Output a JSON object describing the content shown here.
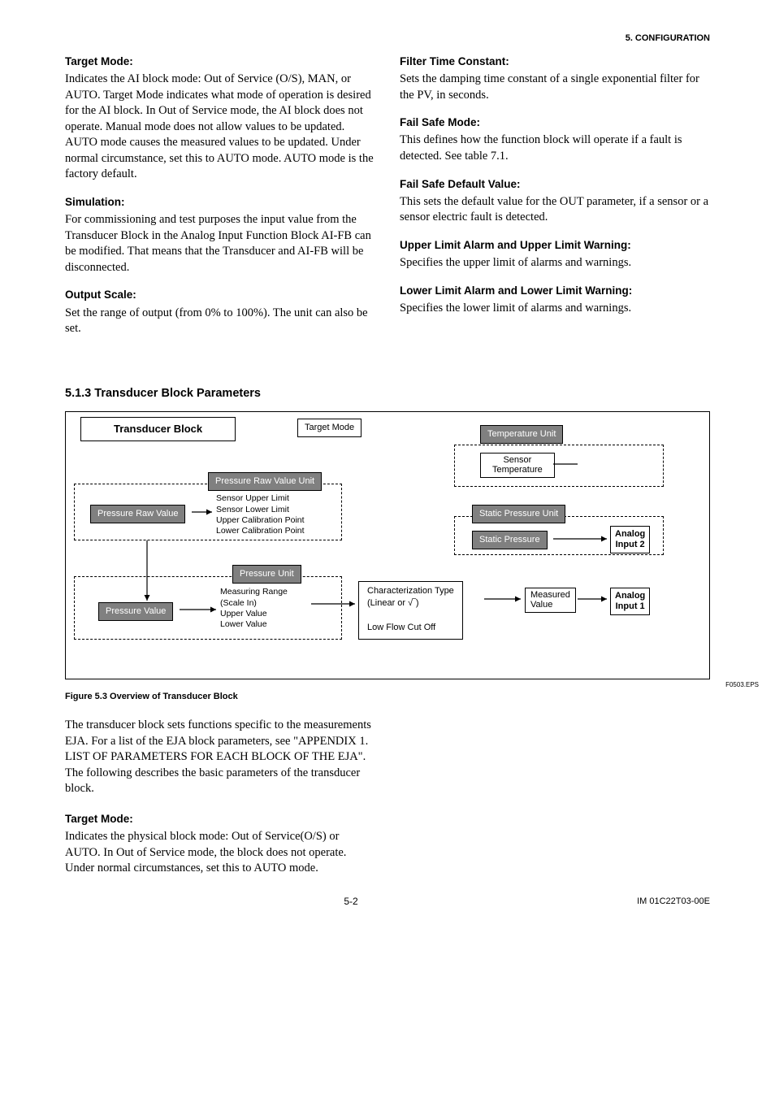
{
  "header": {
    "section": "5.  CONFIGURATION"
  },
  "left": {
    "target_mode": {
      "title": "Target Mode:",
      "body": "Indicates the AI block mode: Out of Service (O/S), MAN, or AUTO. Target Mode indicates what mode of operation is desired for the AI block. In Out of Service mode, the AI block does not operate. Manual mode does not allow values to be updated. AUTO mode causes the measured values to be updated. Under normal circumstance, set this to AUTO mode. AUTO mode is the factory default."
    },
    "simulation": {
      "title": "Simulation:",
      "body": "For commissioning and test purposes the input value from the Transducer Block in the Analog Input Function Block AI-FB can be modified. That means that the Transducer and AI-FB will be disconnected."
    },
    "output_scale": {
      "title": "Output Scale:",
      "body": "Set the range of output (from 0% to 100%). The unit can also be set."
    }
  },
  "right": {
    "filter": {
      "title": "Filter Time Constant:",
      "body": "Sets the damping time constant of a single exponential filter for the PV, in seconds."
    },
    "fail_safe_mode": {
      "title": "Fail Safe Mode:",
      "body": "This defines how the function block will operate if a fault is detected. See table 7.1."
    },
    "fail_safe_default": {
      "title": "Fail Safe Default Value:",
      "body": "This sets the default value for the OUT parameter, if a sensor or a sensor electric fault is detected."
    },
    "upper_limit": {
      "title": "Upper Limit Alarm and Upper Limit Warning:",
      "body": "Specifies the upper limit of alarms and warnings."
    },
    "lower_limit": {
      "title": "Lower Limit Alarm and Lower Limit Warning:",
      "body": "Specifies the lower limit of alarms and warnings."
    }
  },
  "section_513": {
    "title": "5.1.3 Transducer Block Parameters"
  },
  "diagram": {
    "title": "Transducer Block",
    "target_mode": "Target Mode",
    "temp_unit": "Temperature Unit",
    "sensor_temp_l1": "Sensor",
    "sensor_temp_l2": "Temperature",
    "prv_unit": "Pressure Raw Value Unit",
    "limits_l1": "Sensor Upper Limit",
    "limits_l2": "Sensor Lower Limit",
    "limits_l3": "Upper Calibration Point",
    "limits_l4": "Lower Calibration Point",
    "prv": "Pressure Raw Value",
    "sp_unit": "Static Pressure Unit",
    "static_pressure": "Static Pressure",
    "pressure_unit": "Pressure Unit",
    "mr_l1": "Measuring Range",
    "mr_l2": "(Scale In)",
    "mr_l3": "Upper Value",
    "mr_l4": "Lower Value",
    "pressure_value": "Pressure Value",
    "char_l1": "Characterization Type",
    "char_l2": "(Linear or √‾)",
    "char_l3": "Low Flow Cut Off",
    "measured_l1": "Measured",
    "measured_l2": "Value",
    "ai2_l1": "Analog",
    "ai2_l2": "Input 2",
    "ai1_l1": "Analog",
    "ai1_l2": "Input 1",
    "eps": "F0503.EPS"
  },
  "fig_caption": "Figure 5.3 Overview of Transducer Block",
  "after": {
    "intro": "The transducer block sets functions specific to the measurements EJA. For a list of the EJA block parameters, see \"APPENDIX 1.  LIST OF PARAMETERS FOR EACH BLOCK OF THE EJA\". The following describes the basic parameters of the transducer block.",
    "target_mode": {
      "title": "Target Mode:",
      "body": "Indicates the physical block mode: Out of Service(O/S) or AUTO. In Out of Service mode, the block does not operate. Under normal circumstances, set this to AUTO mode."
    }
  },
  "footer": {
    "page": "5-2",
    "doc": "IM 01C22T03-00E"
  }
}
